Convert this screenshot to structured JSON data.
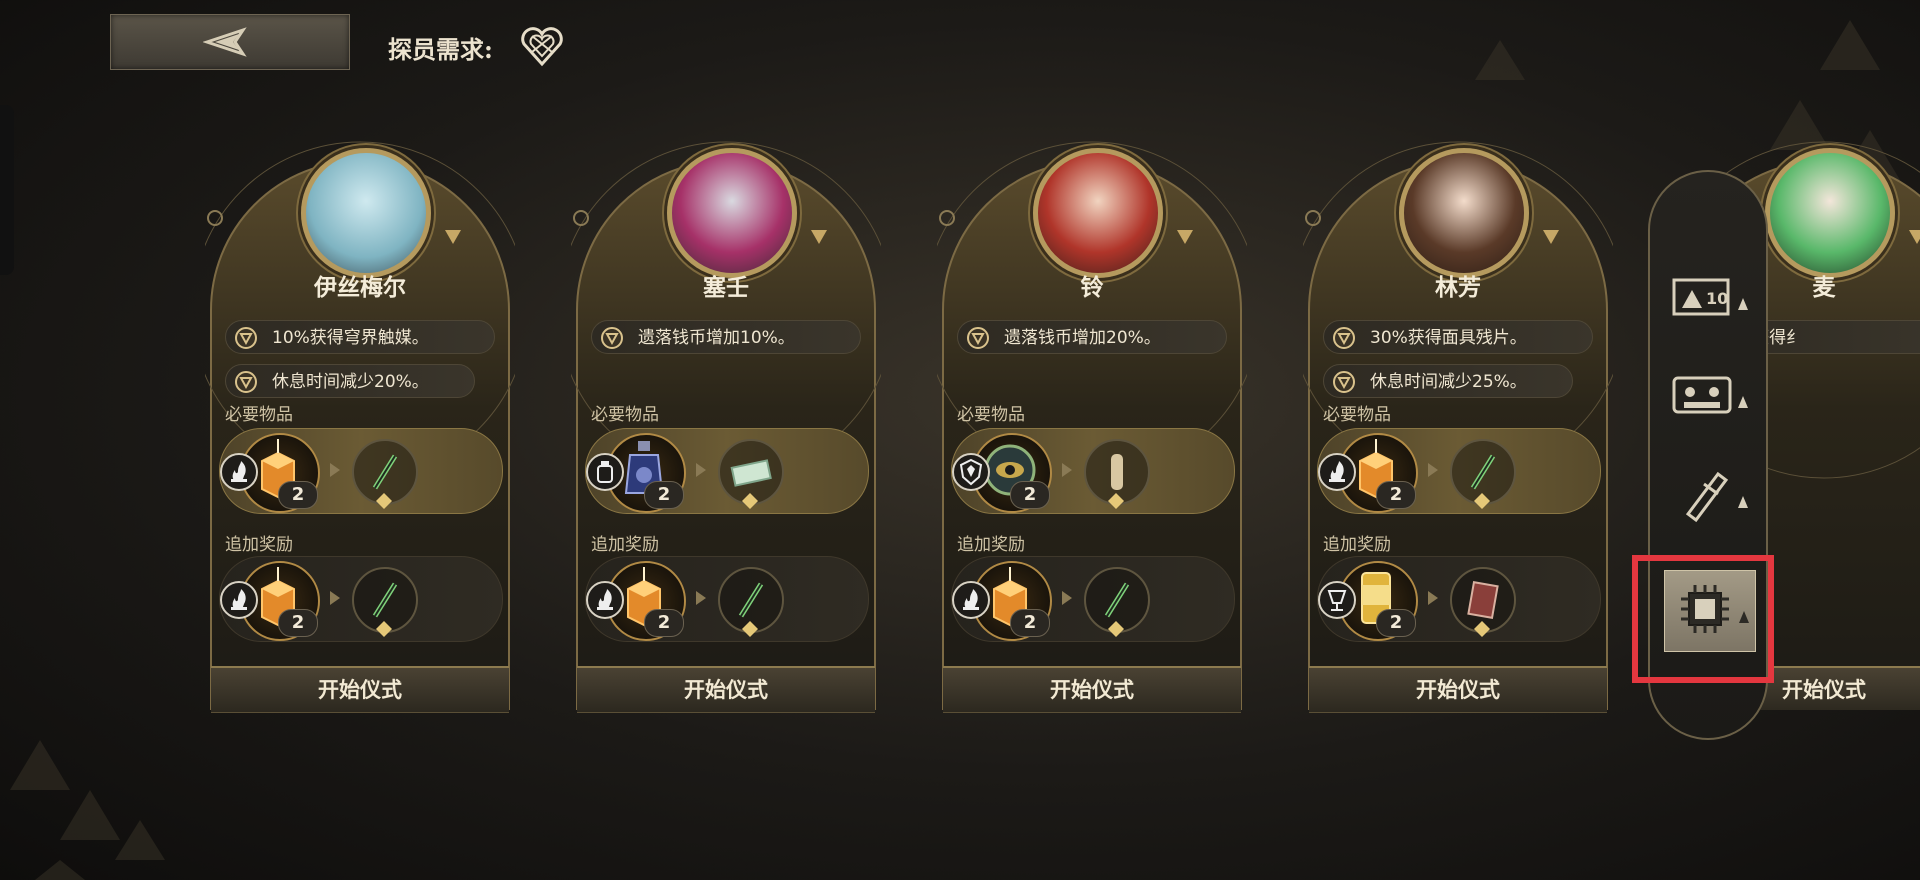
{
  "header": {
    "requirement_label": "探员需求:",
    "back_icon": "back-arrow-icon",
    "requirement_icon": "heart-emblem-icon"
  },
  "labels": {
    "required_items": "必要物品",
    "bonus_rewards": "追加奖励",
    "start_ritual": "开始仪式"
  },
  "characters": [
    {
      "name": "伊丝梅尔",
      "buffs": [
        "10%获得穹界触媒。",
        "休息时间减少20%。"
      ],
      "required": {
        "icon": "lantern-icon",
        "badge": "flame-icon",
        "count": "2",
        "target": "syringe-icon"
      },
      "bonus": {
        "icon": "lantern-icon",
        "badge": "flame-icon",
        "count": "2",
        "target": "syringe-icon"
      }
    },
    {
      "name": "塞壬",
      "buffs": [
        "遗落钱币增加10%。"
      ],
      "required": {
        "icon": "perfume-bottle-icon",
        "badge": "bottle-icon",
        "count": "2",
        "target": "cash-stack-icon"
      },
      "bonus": {
        "icon": "lantern-icon",
        "badge": "flame-icon",
        "count": "2",
        "target": "syringe-icon"
      }
    },
    {
      "name": "铃",
      "buffs": [
        "遗落钱币增加20%。"
      ],
      "required": {
        "icon": "eye-artifact-icon",
        "badge": "shield-icon",
        "count": "2",
        "target": "scroll-icon"
      },
      "bonus": {
        "icon": "lantern-icon",
        "badge": "flame-icon",
        "count": "2",
        "target": "syringe-icon"
      }
    },
    {
      "name": "林芳",
      "buffs": [
        "30%获得面具残片。",
        "休息时间减少25%。"
      ],
      "required": {
        "icon": "lantern-icon",
        "badge": "flame-icon",
        "count": "2",
        "target": "syringe-icon"
      },
      "bonus": {
        "icon": "beer-can-icon",
        "badge": "drink-icon",
        "count": "2",
        "target": "book-icon"
      }
    },
    {
      "name": "麦",
      "buffs": [
        "%获得纟"
      ],
      "partial": true
    }
  ],
  "side_panel": {
    "buttons": [
      {
        "icon": "ticket-10-icon",
        "selected": false
      },
      {
        "icon": "cassette-icon",
        "selected": false
      },
      {
        "icon": "pen-tool-icon",
        "selected": false
      },
      {
        "icon": "chip-icon",
        "selected": true
      }
    ]
  },
  "colors": {
    "gold": "#b59a5e",
    "highlight": "#e4373f",
    "text": "#efe6d1"
  }
}
